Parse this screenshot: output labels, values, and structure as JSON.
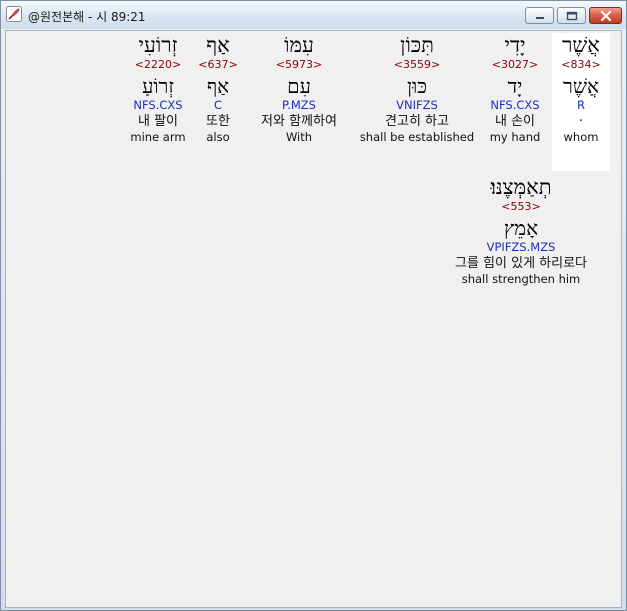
{
  "window": {
    "title": "@원전본해 - 시 89:21",
    "icon": "app-feather-icon",
    "controls": {
      "minimize": "minimize-icon",
      "maximize": "maximize-icon",
      "close": "close-icon"
    }
  },
  "words": [
    {
      "hebrew": "אֲשֶׁר",
      "strong": "<834>",
      "lemma": "אֲשֶׁר",
      "morph": "R",
      "korean": "·",
      "english": "whom"
    },
    {
      "hebrew": "יָדִי",
      "strong": "<3027>",
      "lemma": "יָד",
      "morph": "NFS.CXS",
      "korean": "내 손이",
      "english": "my hand"
    },
    {
      "hebrew": "תִּכּוֹן",
      "strong": "<3559>",
      "lemma": "כּוּן",
      "morph": "VNIFZS",
      "korean": "견고히 하고",
      "english": "shall be established"
    },
    {
      "hebrew": "עִמּוֹ",
      "strong": "<5973>",
      "lemma": "עִם",
      "morph": "P.MZS",
      "korean": "저와 함께하여",
      "english": "With"
    },
    {
      "hebrew": "אַף",
      "strong": "<637>",
      "lemma": "אַף",
      "morph": "C",
      "korean": "또한",
      "english": "also"
    },
    {
      "hebrew": "זְרוֹעִי",
      "strong": "<2220>",
      "lemma": "זְרוֹעַ",
      "morph": "NFS.CXS",
      "korean": "내 팔이",
      "english": "mine arm"
    },
    {
      "hebrew": "תְאַמְּצֶנּוּ׃",
      "strong": "<553>",
      "lemma": "אָמֵץ",
      "morph": "VPIFZS.MZS",
      "korean": "그를 힘이 있게 하리로다",
      "english": "shall strengthen him"
    }
  ]
}
